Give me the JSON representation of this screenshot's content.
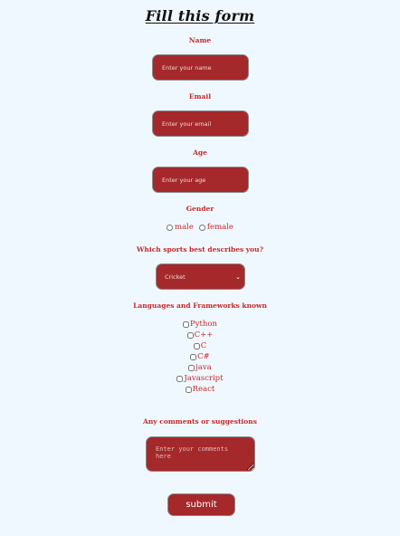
{
  "form": {
    "title": "Fill this form",
    "name": {
      "label": "Name",
      "placeholder": "Enter your name"
    },
    "email": {
      "label": "Email",
      "placeholder": "Enter your email"
    },
    "age": {
      "label": "Age",
      "placeholder": "Enter your age"
    },
    "gender": {
      "label": "Gender",
      "options": [
        "male",
        "female"
      ]
    },
    "sports": {
      "label": "Which sports best describes you?",
      "selected": "Cricket"
    },
    "languages": {
      "label": "Languages and Frameworks known",
      "options": [
        "Python",
        "C++",
        "C",
        "C#",
        "java",
        "Javascript",
        "React"
      ]
    },
    "comments": {
      "label": "Any comments or suggestions",
      "placeholder": "Enter your comments here"
    },
    "submit_label": "submit"
  }
}
